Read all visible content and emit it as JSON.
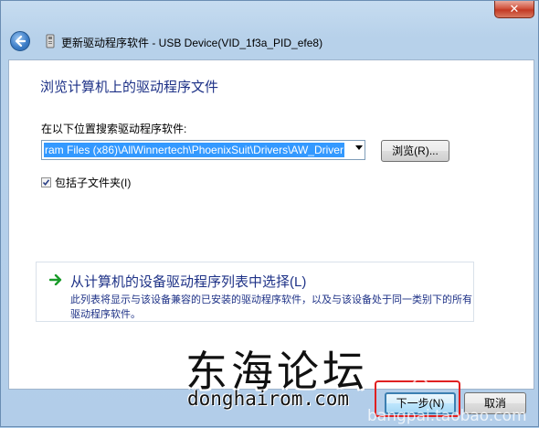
{
  "window": {
    "close_label": "✕",
    "title": "更新驱动程序软件 - USB Device(VID_1f3a_PID_efe8)"
  },
  "main": {
    "heading": "浏览计算机上的驱动程序文件",
    "search_label": "在以下位置搜索驱动程序软件:",
    "path_value": "ram Files (x86)\\AllWinnertech\\PhoenixSuit\\Drivers\\AW_Driver",
    "browse_label": "浏览(R)...",
    "include_subfolders_label": "包括子文件夹(I)",
    "include_subfolders_checked": true,
    "pick_title": "从计算机的设备驱动程序列表中选择(L)",
    "pick_desc": "此列表将显示与该设备兼容的已安装的驱动程序软件，以及与该设备处于同一类别下的所有驱动程序软件。"
  },
  "footer": {
    "next_label": "下一步(N)",
    "cancel_label": "取消"
  },
  "watermarks": {
    "chinese": "东海论坛",
    "english": "donghairom.com",
    "taobao": "bangpai.taobao.com"
  },
  "colors": {
    "heading_blue": "#1e3287",
    "selection_blue": "#3399ff",
    "arrow_green": "#1a9b2a",
    "highlight_red": "#e02020"
  }
}
